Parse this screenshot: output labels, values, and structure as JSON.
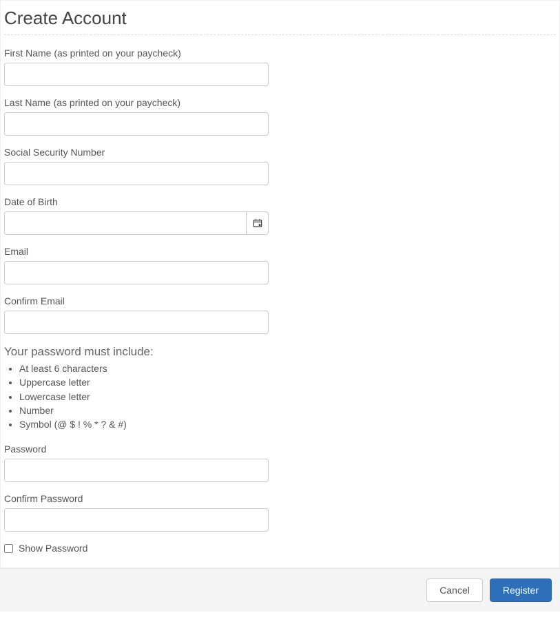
{
  "title": "Create Account",
  "fields": {
    "first_name": {
      "label": "First Name (as printed on your paycheck)",
      "value": ""
    },
    "last_name": {
      "label": "Last Name (as printed on your paycheck)",
      "value": ""
    },
    "ssn": {
      "label": "Social Security Number",
      "value": ""
    },
    "dob": {
      "label": "Date of Birth",
      "value": ""
    },
    "email": {
      "label": "Email",
      "value": ""
    },
    "confirm_email": {
      "label": "Confirm Email",
      "value": ""
    },
    "password": {
      "label": "Password",
      "value": ""
    },
    "confirm_password": {
      "label": "Confirm Password",
      "value": ""
    }
  },
  "password_requirements": {
    "title": "Your password must include:",
    "items": [
      "At least 6 characters",
      "Uppercase letter",
      "Lowercase letter",
      "Number",
      "Symbol (@ $ ! % * ? & #)"
    ]
  },
  "show_password": {
    "label": "Show Password",
    "checked": false
  },
  "buttons": {
    "cancel": "Cancel",
    "register": "Register"
  }
}
